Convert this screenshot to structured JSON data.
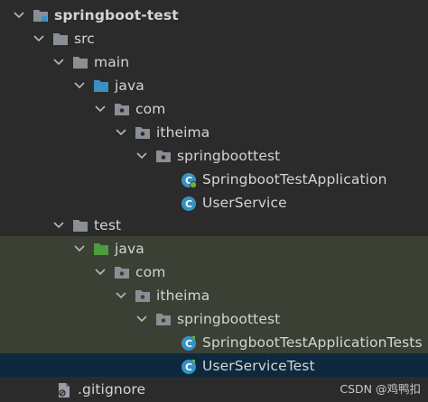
{
  "project": {
    "name": "springboot-test"
  },
  "tree": {
    "src": "src",
    "main": "main",
    "main_java": "java",
    "main_com": "com",
    "main_itheima": "itheima",
    "main_pkg": "springboottest",
    "main_classes": [
      "SpringbootTestApplication",
      "UserService"
    ],
    "test": "test",
    "test_java": "java",
    "test_com": "com",
    "test_itheima": "itheima",
    "test_pkg": "springboottest",
    "test_classes": [
      "SpringbootTestApplicationTests",
      "UserServiceTest"
    ],
    "gitignore": ".gitignore"
  },
  "watermark": "CSDN @鸡鸭扣",
  "colors": {
    "background": "#2b2b2b",
    "test_highlight": "#3b4034",
    "selection": "#0d293e",
    "folder": "#8a8f96",
    "main_java_folder": "#3d8ec2",
    "test_java_folder": "#4e9a3e",
    "class_icon": "#3592c4"
  }
}
